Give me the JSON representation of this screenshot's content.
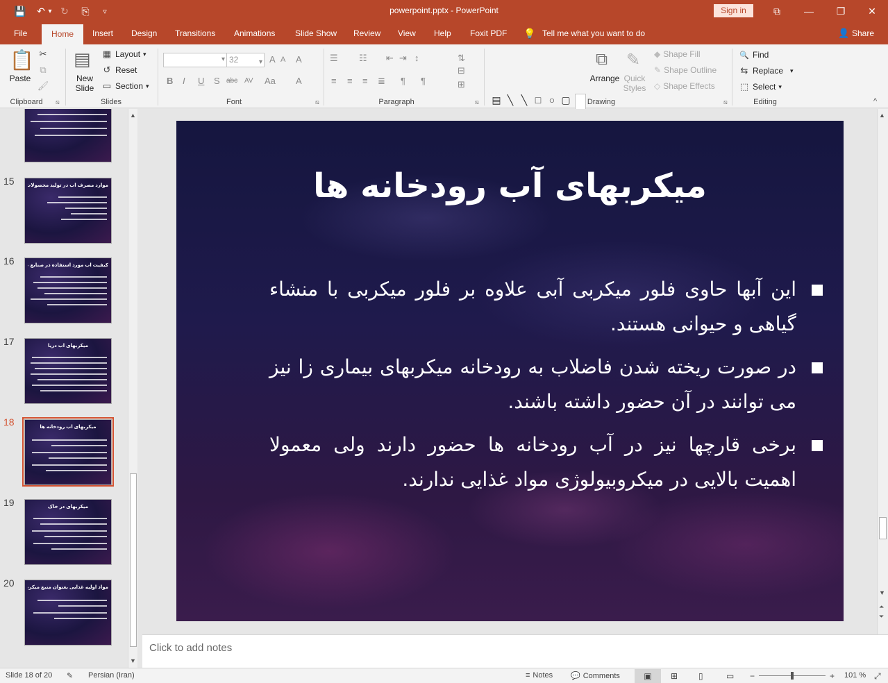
{
  "app": {
    "doc_title": "powerpoint.pptx  -  PowerPoint",
    "signin": "Sign in",
    "colors": {
      "brand": "#b7472a",
      "selection": "#d35230"
    }
  },
  "quick_access": {
    "save_icon": "💾",
    "undo_icon": "↶",
    "undo_dropdown_icon": "▾",
    "redo_icon": "↻",
    "present_icon": "⎘",
    "customize_icon": "▿"
  },
  "window": {
    "ribbon_display_icon": "⧉",
    "minimize_icon": "—",
    "restore_icon": "❐",
    "close_icon": "✕"
  },
  "tabs": [
    "File",
    "Home",
    "Insert",
    "Design",
    "Transitions",
    "Animations",
    "Slide Show",
    "Review",
    "View",
    "Help",
    "Foxit PDF"
  ],
  "tell_me": {
    "icon": "💡",
    "label": "Tell me what you want to do"
  },
  "share": {
    "icon": "👤",
    "label": "Share"
  },
  "ribbon": {
    "clipboard": {
      "label": "Clipboard",
      "paste": "Paste",
      "paste_icon": "📋",
      "cut_icon": "✂",
      "copy_icon": "⧉",
      "format_painter_icon": "🖌"
    },
    "slides": {
      "label": "Slides",
      "new_slide": "New Slide",
      "new_slide_icon": "▤",
      "layout": "Layout",
      "reset": "Reset",
      "section": "Section",
      "layout_icon": "▦",
      "reset_icon": "↺",
      "section_icon": "▭"
    },
    "font": {
      "label": "Font",
      "font_name": "",
      "font_size": "32",
      "bold": "B",
      "italic": "I",
      "underline": "U",
      "shadow": "S",
      "strike": "abc",
      "spacing": "AV",
      "case": "Aa",
      "color": "A",
      "grow": "A",
      "shrink": "A",
      "clear": "A"
    },
    "paragraph": {
      "label": "Paragraph"
    },
    "drawing": {
      "label": "Drawing",
      "arrange": "Arrange",
      "quick_styles": "Quick Styles",
      "shape_fill": "Shape Fill",
      "shape_outline": "Shape Outline",
      "shape_effects": "Shape Effects",
      "arrange_icon": "⧉",
      "quick_styles_icon": "✎"
    },
    "editing": {
      "label": "Editing",
      "find": "Find",
      "replace": "Replace",
      "select": "Select",
      "find_icon": "🔍",
      "replace_icon": "⇆",
      "select_icon": "⬚"
    },
    "collapse_icon": "^",
    "launcher_icon": "⧅"
  },
  "thumbnails": [
    {
      "num": "",
      "title": ""
    },
    {
      "num": "15",
      "title": "موارد مصرف آب در تولید محصولات غذایی"
    },
    {
      "num": "16",
      "title": "کیفیت آب مورد استفاده در صنایع غذایی"
    },
    {
      "num": "17",
      "title": "میکربهای آب دریا"
    },
    {
      "num": "18",
      "title": "میکربهای آب رودخانه ها"
    },
    {
      "num": "19",
      "title": "میکربهای در خاک"
    },
    {
      "num": "20",
      "title": "مواد اولیه غذایی بعنوان منبع میکرب"
    }
  ],
  "slide": {
    "title": "میکربهای آب رودخانه ها",
    "bullets": [
      "این آبها حاوی فلور میکربی آبی علاوه بر فلور میکربی با منشاء گیاهی و حیوانی هستند.",
      "در صورت ریخته شدن فاضلاب به رودخانه میکربهای بیماری زا نیز می توانند در آن حضور داشته باشند.",
      "برخی قارچها نیز در آب رودخانه ها حضور دارند ولی معمولا اهمیت بالایی در میکروبیولوژی مواد غذایی ندارند."
    ]
  },
  "notes": {
    "placeholder": "Click to add notes"
  },
  "status": {
    "slide_info": "Slide 18 of 20",
    "language": "Persian (Iran)",
    "notes": "Notes",
    "comments": "Comments",
    "zoom": "101 %",
    "spell_icon": "✎",
    "notes_icon": "≡",
    "comments_icon": "💬",
    "normal_view_icon": "▣",
    "sorter_view_icon": "⊞",
    "reading_view_icon": "▯",
    "slideshow_view_icon": "▭",
    "zoom_out_icon": "−",
    "zoom_in_icon": "+",
    "fit_icon": "⤢"
  }
}
